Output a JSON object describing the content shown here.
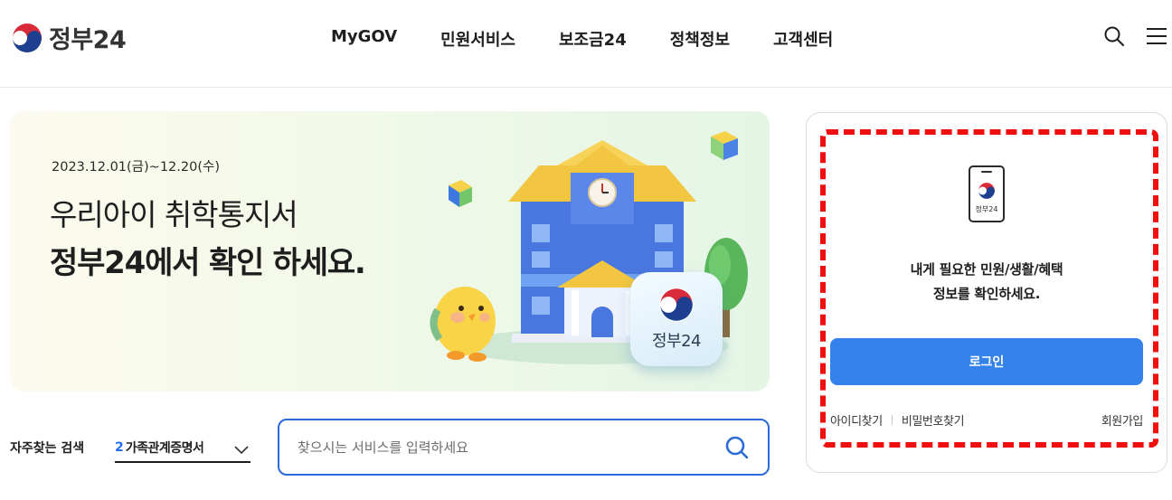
{
  "header": {
    "logo_text": "정부24",
    "nav": [
      "MyGOV",
      "민원서비스",
      "보조금24",
      "정책정보",
      "고객센터"
    ],
    "icons": [
      "search-icon",
      "menu-icon"
    ]
  },
  "banner": {
    "date": "2023.12.01(금)~12.20(수)",
    "line1": "우리아이 취학통지서",
    "line2": "정부24에서 확인 하세요.",
    "tile_label": "정부24"
  },
  "frequent": {
    "label": "자주찾는 검색",
    "number": "2",
    "selected": "가족관계증명서"
  },
  "search": {
    "placeholder": "찾으시는 서비스를 입력하세요"
  },
  "login": {
    "phone_label": "정부24",
    "message": "내게 필요한 민원/생활/혜택\n정보를 확인하세요.",
    "button": "로그인",
    "find_id": "아이디찾기",
    "find_pw": "비밀번호찾기",
    "signup": "회원가입"
  },
  "colors": {
    "accent": "#3482ea",
    "search_border": "#2a6bd8",
    "highlight_dash": "#f00f0f"
  }
}
